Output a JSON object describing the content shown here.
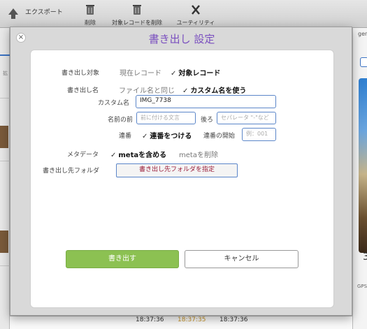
{
  "toolbar": {
    "export_label": "エクスポート",
    "delete_label": "削除",
    "delete_records_label": "対象レコードを削除",
    "utility_label": "ユーティリティ"
  },
  "background": {
    "right_header": "gen",
    "right_number": "3",
    "right_gps": "GPS",
    "left_label": "拡",
    "times": [
      "18:37:36",
      "18:37:35",
      "18:37:36"
    ]
  },
  "dialog": {
    "close_symbol": "×",
    "title": "書き出し 設定",
    "target": {
      "label": "書き出し対象",
      "option_current": "現在レコード",
      "option_target": "対象レコード",
      "selected": "option_target"
    },
    "name": {
      "label": "書き出し名",
      "option_same": "ファイル名と同じ",
      "option_custom": "カスタム名を使う",
      "selected": "option_custom",
      "custom_label": "カスタム名",
      "custom_value": "IMG_7738",
      "before_label": "名前の前",
      "before_placeholder": "前に付ける文言",
      "after_label": "後ろ",
      "after_placeholder": "セパレータ \"-\"など",
      "serial_label": "連番",
      "serial_option": "連番をつける",
      "serial_start_label": "連番の開始",
      "serial_start_placeholder": "例：001"
    },
    "meta": {
      "label": "メタデータ",
      "option_include": "metaを含める",
      "option_remove": "metaを削除",
      "selected": "option_include"
    },
    "folder": {
      "label": "書き出し先フォルダ",
      "button_label": "書き出し先フォルダを指定"
    },
    "export_button": "書き出す",
    "cancel_button": "キャンセル",
    "check_mark": "✓"
  },
  "colors": {
    "title": "#7a4fbf",
    "export_button": "#8cc152",
    "field_border": "#5b86c9",
    "folder_button_text": "#9a1e3a"
  }
}
